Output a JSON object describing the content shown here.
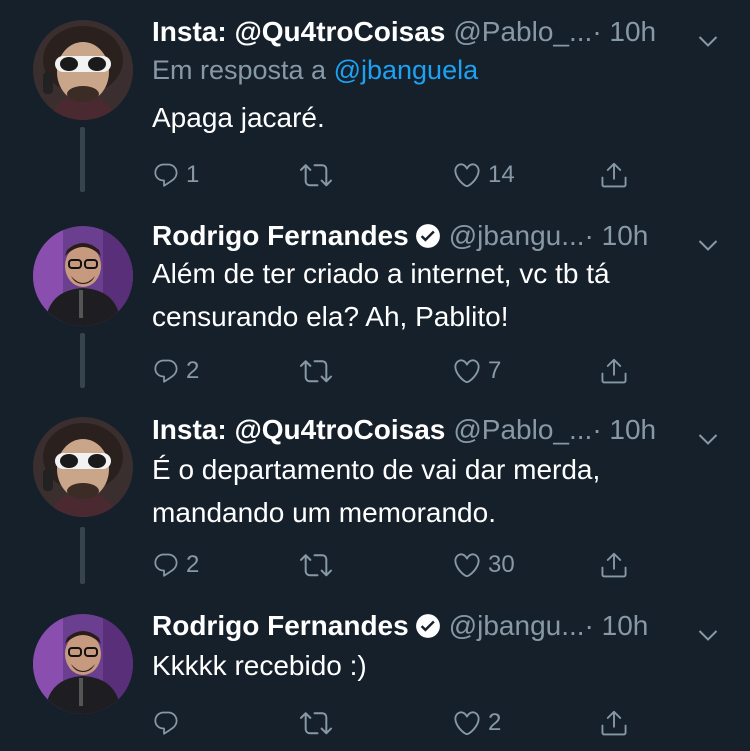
{
  "tweets": [
    {
      "name": "Insta: @Qu4troCoisas",
      "handle": "@Pablo_...",
      "time": "· 10h",
      "verified": false,
      "reply_prefix": "Em resposta a ",
      "reply_to": "@jbanguela",
      "text": [
        "Apaga jacaré."
      ],
      "replies": "1",
      "retweets": "",
      "likes": "14"
    },
    {
      "name": "Rodrigo Fernandes",
      "handle": "@jbangu...",
      "time": "· 10h",
      "verified": true,
      "text": [
        "Além de ter criado a internet, vc tb tá",
        "censurando ela? Ah, Pablito!"
      ],
      "replies": "2",
      "retweets": "",
      "likes": "7"
    },
    {
      "name": "Insta: @Qu4troCoisas",
      "handle": "@Pablo_...",
      "time": "· 10h",
      "verified": false,
      "text": [
        "É o departamento de vai dar merda,",
        "mandando um memorando."
      ],
      "replies": "2",
      "retweets": "",
      "likes": "30"
    },
    {
      "name": "Rodrigo Fernandes",
      "handle": "@jbangu...",
      "time": "· 10h",
      "verified": true,
      "text": [
        "Kkkkk recebido :)"
      ],
      "replies": "",
      "retweets": "",
      "likes": "2"
    }
  ],
  "colors": {
    "background": "#15202b",
    "secondary_text": "#8899a6",
    "link": "#1da1f2",
    "thread_line": "#38444d"
  },
  "icons": [
    "reply-icon",
    "retweet-icon",
    "like-icon",
    "share-icon",
    "chevron-down-icon",
    "verified-badge-icon"
  ]
}
